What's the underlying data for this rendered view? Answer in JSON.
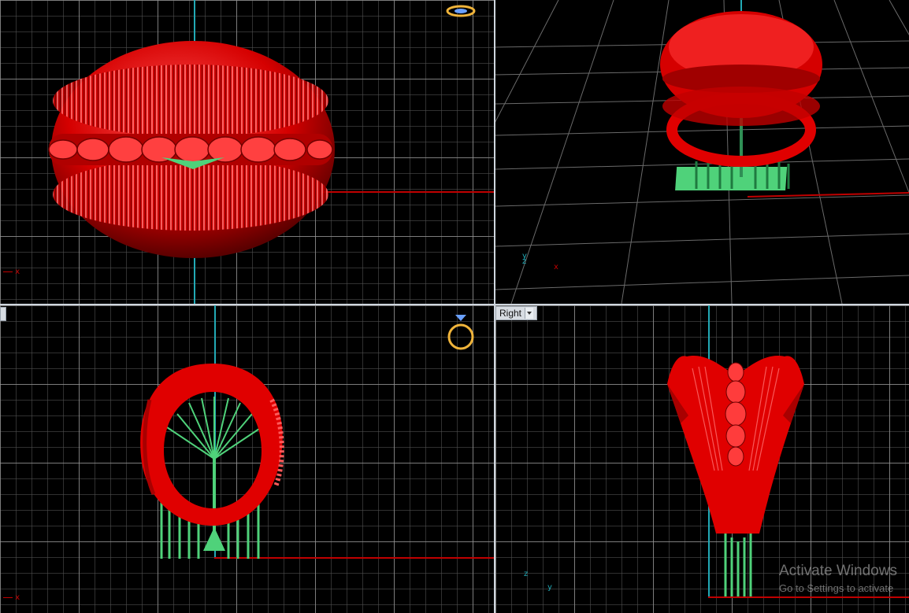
{
  "viewports": {
    "right": {
      "label": "Right"
    }
  },
  "axes": {
    "x": "x",
    "y": "y",
    "z": "z"
  },
  "watermark": {
    "title": "Activate Windows",
    "subtitle": "Go to Settings to activate"
  },
  "colors": {
    "background": "#000000",
    "grid_major": "#969696",
    "grid_minor": "#505050",
    "model_red": "#e00000",
    "support_green": "#4fd27a",
    "axis_red": "#c00000",
    "axis_cyan": "#22a9b5",
    "gem_icon": "#f0b43a"
  },
  "icons": {
    "top": "ring-flat-icon",
    "front": "ring-front-icon"
  }
}
